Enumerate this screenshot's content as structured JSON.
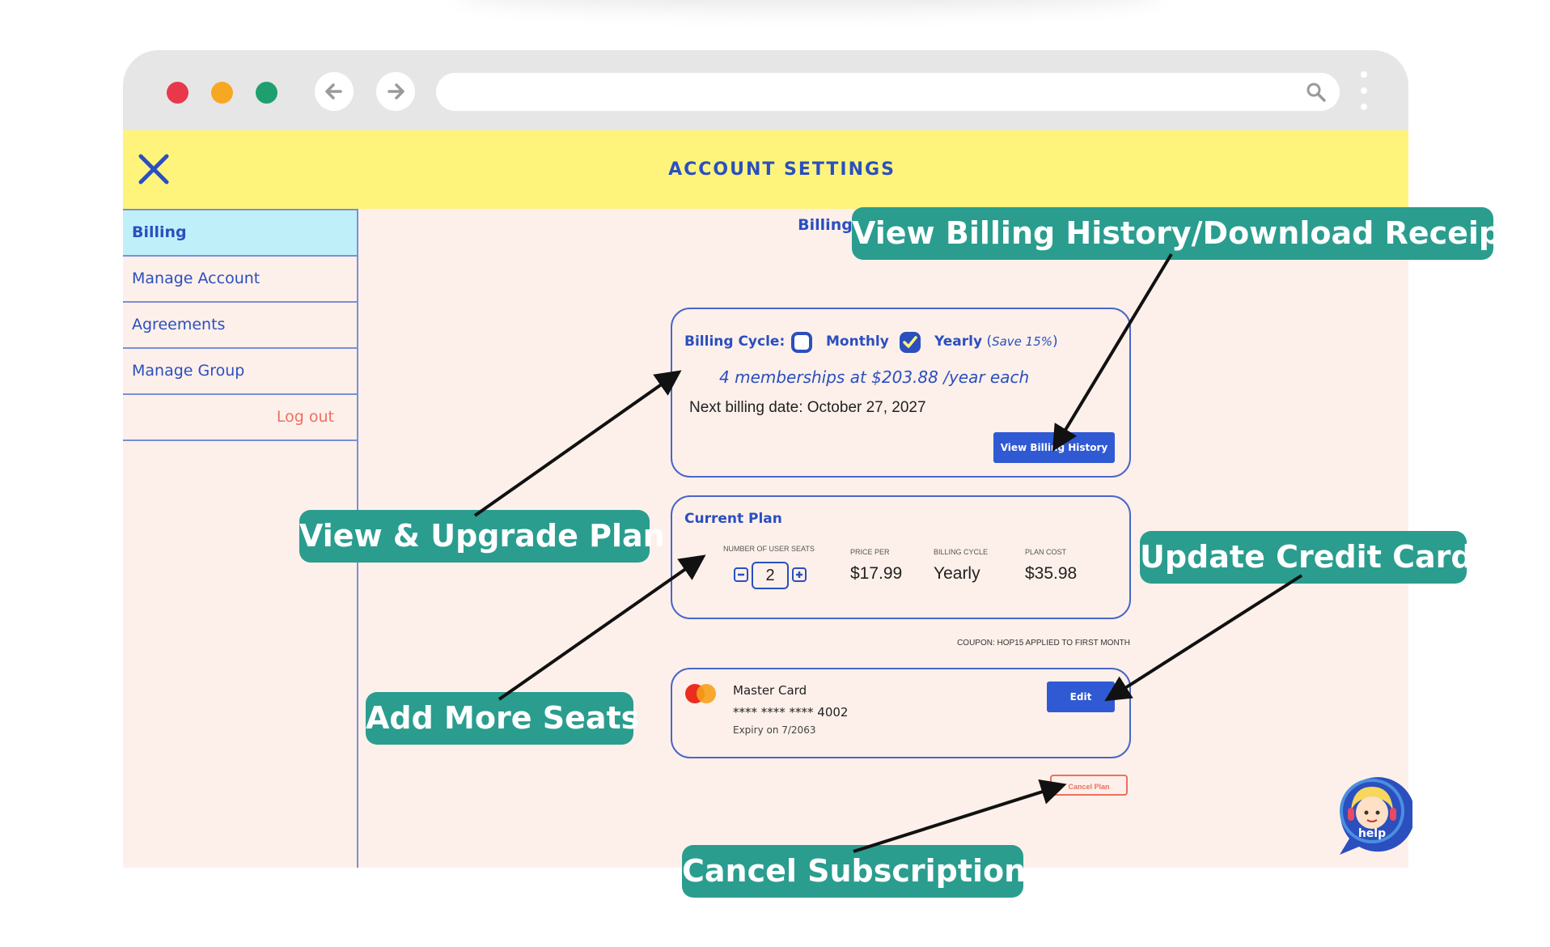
{
  "header": {
    "title": "ACCOUNT SETTINGS"
  },
  "sidebar": {
    "items": [
      {
        "label": "Billing"
      },
      {
        "label": "Manage Account"
      },
      {
        "label": "Agreements"
      },
      {
        "label": "Manage Group"
      }
    ],
    "logout": "Log out"
  },
  "billing": {
    "title": "Billing",
    "cycle_label": "Billing Cycle:",
    "monthly": "Monthly",
    "yearly": "Yearly",
    "save_open": "(",
    "save": "Save 15%",
    "save_close": ")",
    "memberships": "4 memberships at $203.88 /year each",
    "next_billing": "Next billing date: October 27, 2027",
    "history_button": "View Billing History"
  },
  "plan": {
    "title": "Current Plan",
    "seats_label": "NUMBER OF USER SEATS",
    "seats_value": "2",
    "price_label": "PRICE PER",
    "price_value": "$17.99",
    "cycle_label": "BILLING CYCLE",
    "cycle_value": "Yearly",
    "cost_label": "PLAN COST",
    "cost_value": "$35.98",
    "coupon": "COUPON: HOP15 APPLIED TO FIRST MONTH"
  },
  "card": {
    "brand": "Master Card",
    "number": "**** **** **** 4002",
    "expiry": "Expiry on 7/2063",
    "edit": "Edit"
  },
  "cancel": {
    "label": "Cancel Plan"
  },
  "help": {
    "label": "help"
  },
  "callouts": {
    "history": "View Billing History/Download Receipts",
    "upgrade": "View & Upgrade Plan",
    "credit": "Update Credit Card",
    "seats": "Add More Seats",
    "cancel": "Cancel Subscription"
  },
  "colors": {
    "accent": "#2b4fbf",
    "header": "#fef47c",
    "callout": "#2a9d8f",
    "cancel": "#ef6f5e"
  }
}
